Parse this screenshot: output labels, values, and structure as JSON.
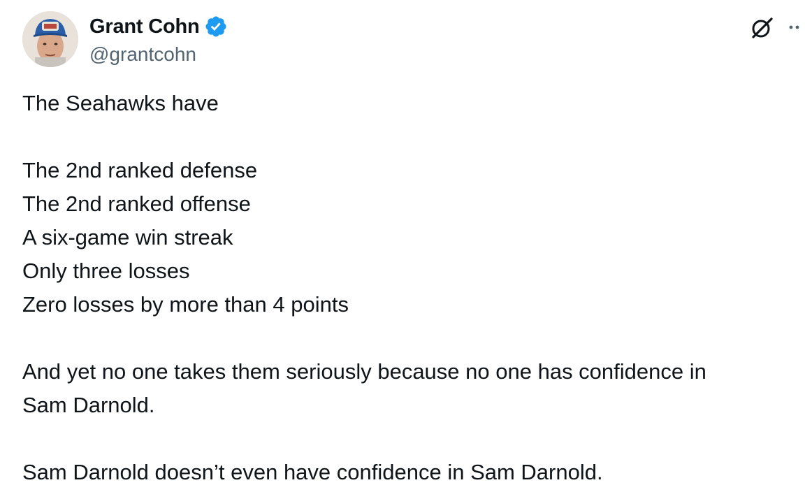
{
  "author": {
    "display_name": "Grant Cohn",
    "handle": "@grantcohn",
    "verified": true,
    "verified_color": "#1d9bf0",
    "avatar_icon": "avatar-photo"
  },
  "header_icons": {
    "grok": "grok-icon",
    "more": "more-options-icon"
  },
  "tweet": {
    "intro": "The Seahawks have",
    "list": [
      "The 2nd ranked defense",
      "The 2nd ranked offense",
      "A six-game win streak",
      "Only three losses",
      "Zero losses by more than 4 points"
    ],
    "paragraph_2_line_1": "And yet no one takes them seriously because no one has confidence in",
    "paragraph_2_line_2": "Sam Darnold.",
    "paragraph_3": "Sam Darnold doesn’t even have confidence in Sam Darnold."
  },
  "colors": {
    "text": "#0f1419",
    "secondary_text": "#536471",
    "accent": "#1d9bf0"
  }
}
